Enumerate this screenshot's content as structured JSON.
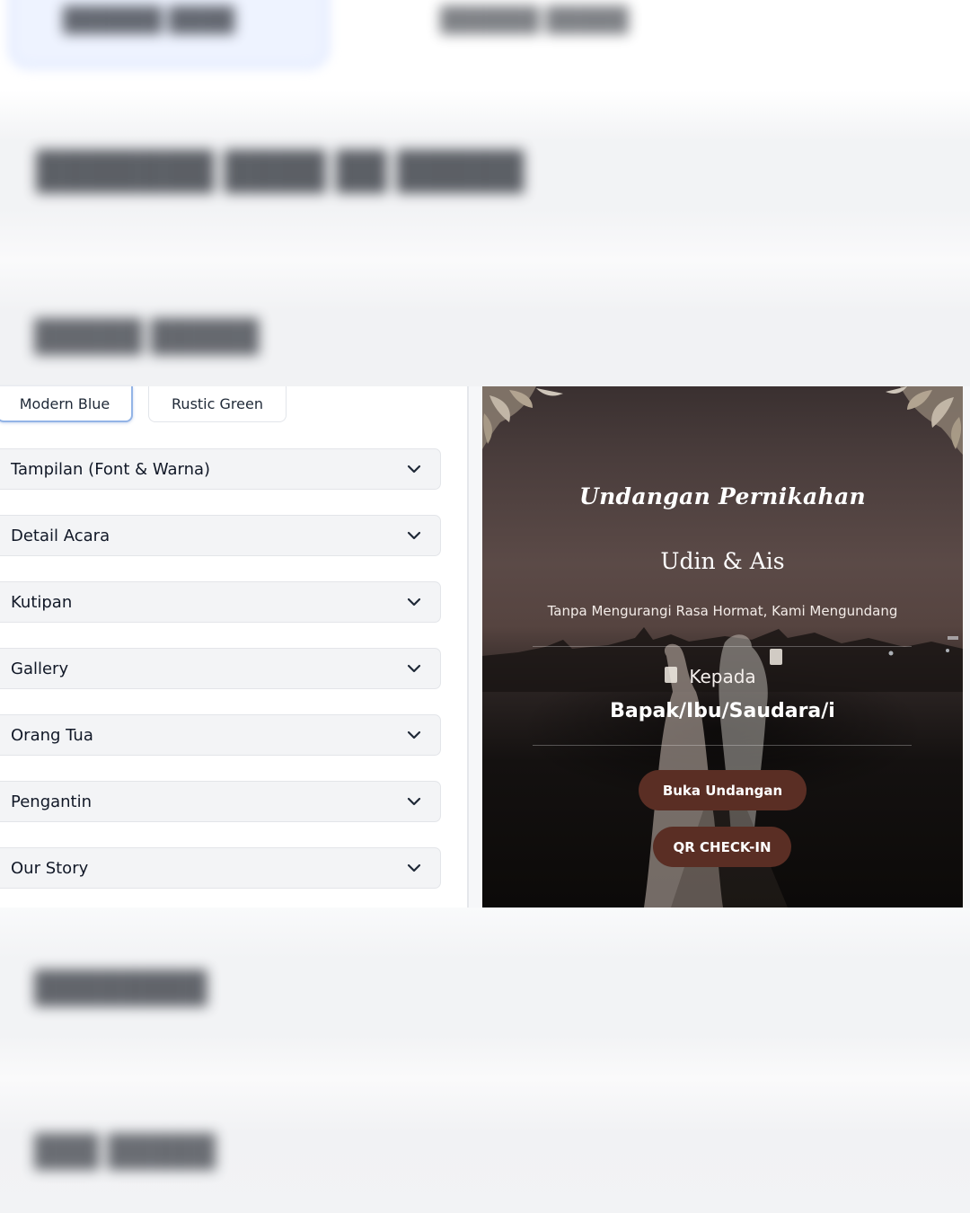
{
  "templates": {
    "buttons": [
      "Modern Blue",
      "Rustic Green"
    ],
    "active": "Modern Blue"
  },
  "accordion": [
    {
      "label": "Tampilan (Font & Warna)",
      "icon": "chevron-down-icon"
    },
    {
      "label": "Detail Acara",
      "icon": "chevron-down-icon"
    },
    {
      "label": "Kutipan",
      "icon": "chevron-down-icon"
    },
    {
      "label": "Gallery",
      "icon": "chevron-down-icon"
    },
    {
      "label": "Orang Tua",
      "icon": "chevron-down-icon"
    },
    {
      "label": "Pengantin",
      "icon": "chevron-down-icon"
    },
    {
      "label": "Our Story",
      "icon": "chevron-down-icon"
    }
  ],
  "preview": {
    "title": "Undangan Pernikahan",
    "couple": "Udin & Ais",
    "subtitle": "Tanpa Mengurangi Rasa Hormat, Kami Mengundang",
    "to_label": "Kepada",
    "guest": "Bapak/Ibu/Saudara/i",
    "open_button": "Buka Undangan",
    "qr_button": "QR CHECK-IN"
  },
  "colors": {
    "accent_button": "#5a2e24",
    "active_border": "#93b4e6",
    "accordion_bg": "#f3f4f6"
  }
}
